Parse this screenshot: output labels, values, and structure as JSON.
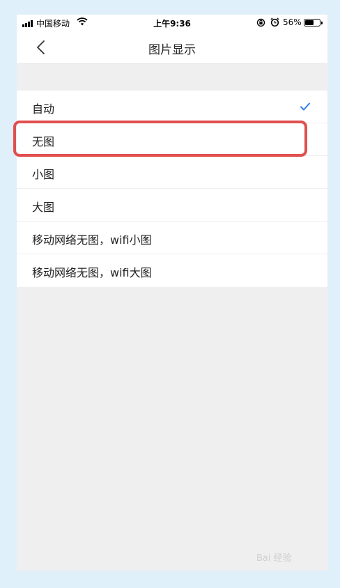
{
  "status_bar": {
    "carrier": "中国移动",
    "time": "上午9:36",
    "battery_pct": "56%",
    "battery_level": 0.56
  },
  "nav": {
    "title": "图片显示",
    "back_icon": "chevron-left-icon"
  },
  "options": [
    {
      "label": "自动",
      "selected": true
    },
    {
      "label": "无图",
      "selected": false,
      "highlighted": true
    },
    {
      "label": "小图",
      "selected": false
    },
    {
      "label": "大图",
      "selected": false
    },
    {
      "label": "移动网络无图，wifi小图",
      "selected": false
    },
    {
      "label": "移动网络无图，wifi大图",
      "selected": false
    }
  ],
  "colors": {
    "accent": "#2f7ee9",
    "highlight": "#e0504f",
    "background": "#efefef"
  },
  "watermark": "Bai 经验"
}
